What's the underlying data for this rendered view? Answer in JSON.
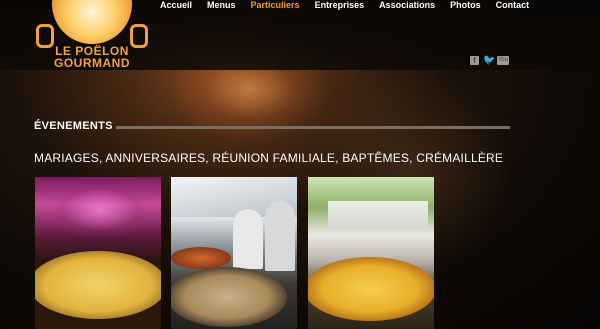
{
  "logo": {
    "line1": "LE POËLON",
    "line2": "GOURMAND"
  },
  "nav": {
    "items": [
      {
        "label": "Accueil"
      },
      {
        "label": "Menus"
      },
      {
        "label": "Particuliers",
        "active": true
      },
      {
        "label": "Entreprises"
      },
      {
        "label": "Associations"
      },
      {
        "label": "Photos"
      },
      {
        "label": "Contact"
      }
    ],
    "active_color": "#f29b2e"
  },
  "social": {
    "icons": [
      "facebook-icon",
      "twitter-icon",
      "youtube-icon"
    ],
    "facebook_glyph": "f",
    "twitter_glyph": "🐦",
    "youtube_glyph": "You"
  },
  "section": {
    "title": "ÉVENEMENTS",
    "subtitle": "MARIAGES, ANNIVERSAIRES, RÉUNION FAMILIALE, BAPTÊMES, CRÉMAILLÈRE"
  },
  "photos": [
    {
      "subject": "paella pan at purple-lit reception"
    },
    {
      "subject": "chefs preparing paella under tent"
    },
    {
      "subject": "paella served at outdoor wedding"
    }
  ]
}
